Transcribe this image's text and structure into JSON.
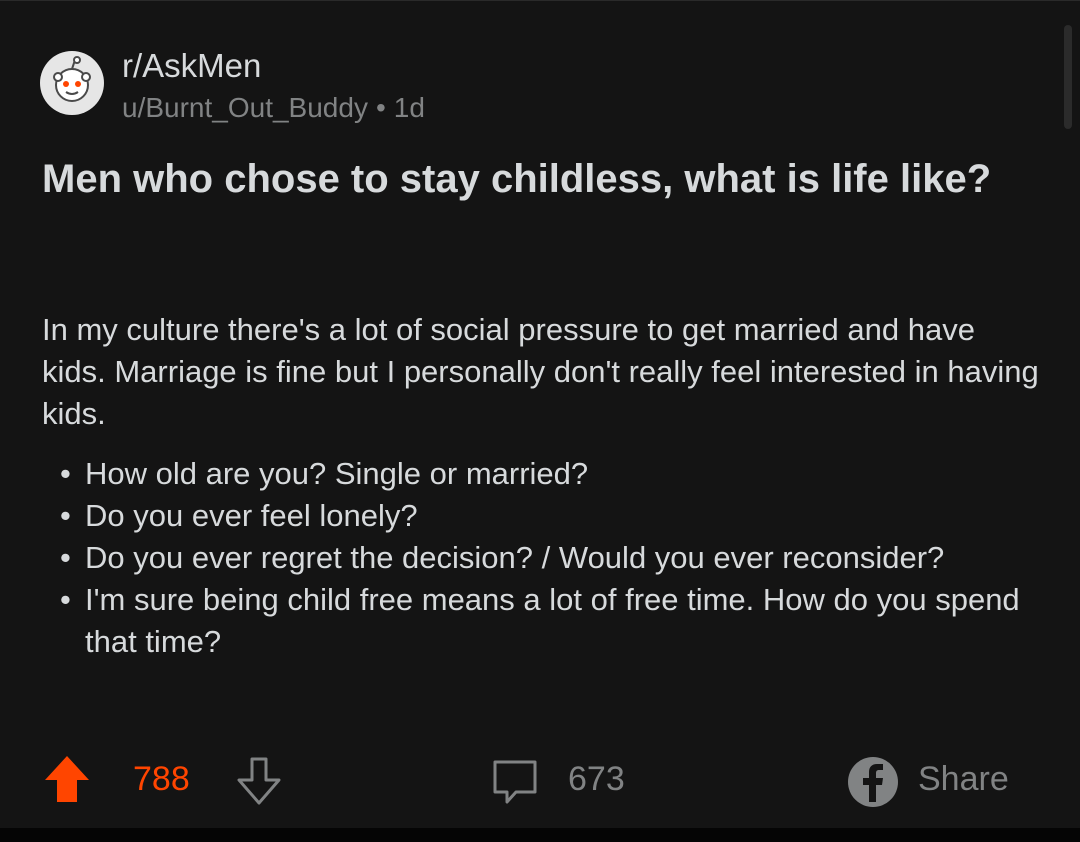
{
  "post": {
    "subreddit": "r/AskMen",
    "author": "u/Burnt_Out_Buddy",
    "separator": "•",
    "age": "1d",
    "title": "Men who chose to stay childless, what is life like?",
    "body": "In my culture there's a lot of social pressure to get married and have kids. Marriage is fine but I personally don't really feel interested in having kids.",
    "bullets": [
      "How old are you? Single or married?",
      "Do you ever feel lonely?",
      "Do you ever regret the decision? / Would you ever reconsider?",
      "I'm sure being child free means a lot of free time. How do you spend that time?"
    ]
  },
  "actions": {
    "vote_count": "788",
    "comment_count": "673",
    "share_label": "Share"
  },
  "icons": {
    "avatar": "snoo-avatar-icon",
    "upvote": "upvote-arrow-icon",
    "downvote": "downvote-arrow-icon",
    "comment": "comment-bubble-icon",
    "share": "facebook-share-icon"
  },
  "colors": {
    "background": "#141414",
    "text": "#d7dadc",
    "muted": "#818384",
    "upvote": "#ff4500"
  }
}
